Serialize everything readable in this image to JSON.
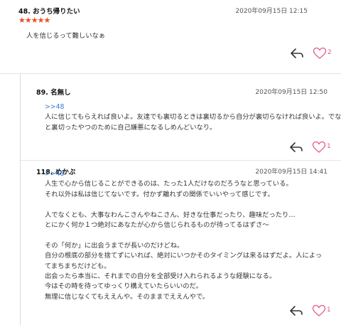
{
  "comments": [
    {
      "author": "48. おうち帰りたい",
      "date": "2020年09月15日 12:15",
      "stars": "★★★★★",
      "lines": [
        "人を信じるって難しいなぁ"
      ],
      "likes": "2"
    },
    {
      "author": "89. 名無し",
      "date": "2020年09月15日 12:50",
      "anchor": ">>48",
      "lines": [
        "人に信じてもらえれば良いよ。友達でも裏切るときは裏切るから自分が裏切らなければ良いよ。でないと裏切ったやつのために自己嫌悪になるしめんどいなり。"
      ],
      "lines_wrapped": [
        "人に信じてもらえれば良いよ。友達でも裏切るときは裏切るから自分が裏切らなければ良いよ。でない",
        "と裏切ったやつのために自己嫌悪になるしめんどいなり。"
      ],
      "likes": "1"
    },
    {
      "author": "118. めかぶ",
      "date": "2020年09月15日 14:41",
      "anchor": ">>48",
      "lines": [
        "人生で心から信じることができるのは、たった1人だけなのだろうなと思っている。",
        "それ以外は私は信じてないです。付かず離れずの関係でいいやって感じです。",
        "",
        "人でなくとも、大事なわんこさんやねこさん、好きな仕事だったり、趣味だったり…",
        "とにかく何か１つ絶対にあなたが心から信じられるものが待ってるはずさ〜",
        "",
        "その「何か」に出会うまでが長いのだけどね。",
        "自分の根底の部分を捨てずにいれば、絶対にいつかそのタイミングは来るはずだよ。人によってまちまちだけども。",
        "出会ったら本当に、それまでの自分を全部受け入れられるような経験になる。",
        "今はその時を待ってゆっくり構えていたらいいのだ。",
        "無理に信じなくてもええんや。そのままでええんやで。"
      ],
      "likes": "1"
    }
  ],
  "icons": {
    "reply": "reply-arrow-icon",
    "like": "heart-outline-icon"
  },
  "colors": {
    "star": "#f24b1a",
    "like": "#e9548c",
    "anchor": "#3a7ec8"
  }
}
